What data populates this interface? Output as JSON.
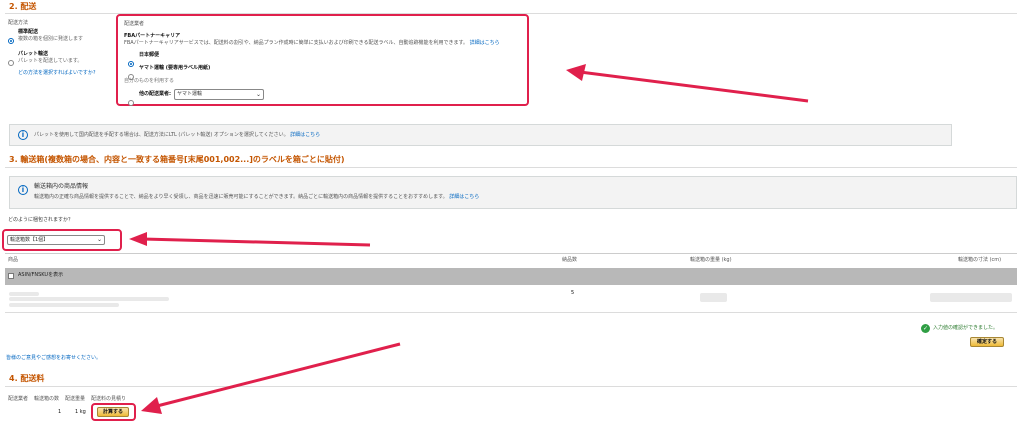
{
  "sections": {
    "s2": "2. 配送",
    "s3": "3. 輸送箱(複数箱の場合、内容と一致する箱番号[末尾001,002...]のラベルを箱ごとに貼付)",
    "s4": "4. 配送料"
  },
  "shipping_method": {
    "label": "配送方法",
    "standard": {
      "title": "標準配送",
      "desc": "複数の箱を個別に発送します",
      "selected": true
    },
    "pallet": {
      "title": "パレット輸送",
      "desc": "パレットを配送しています。",
      "selected": false
    },
    "help_link": "どの方法を選択すればよいですか?"
  },
  "carrier": {
    "label": "配送業者",
    "fba_title": "FBAパートナーキャリア",
    "fba_desc": "FBAパートナーキャリアサービスでは、配送料の割引や、納品プラン作成時に簡単に支払いおよび印刷できる配送ラベル、自動追跡機能を利用できます。",
    "fba_link": "詳細はこちら",
    "option1": "日本郵便",
    "option2": "ヤマト運輸 (要専用ラベル用紙)",
    "own_label": "自分のものを利用する",
    "other_label": "他の配送業者:",
    "other_value": "ヤマト運輸"
  },
  "pallet_notice": {
    "text": "パレットを使用して国内配送を手配する場合は、配送方法にLTL (パレット輸送) オプションを選択してください。",
    "link": "詳細はこちら"
  },
  "box_info": {
    "title": "輸送箱内の商品情報",
    "desc": "輸送箱内の正確な商品情報を提供することで、納品をより早く受領し、商品を迅速に販売可能にすることができます。納品ごとに輸送箱内の商品情報を提供することをおすすめします。",
    "link": "詳細はこちら"
  },
  "packing": {
    "question": "どのように梱包されますか？",
    "select_value": "輸送箱数【1個】"
  },
  "table": {
    "headers": [
      "商品",
      "納品数",
      "輸送箱の重量 (kg)",
      "輸送箱の寸法 (cm)"
    ],
    "toggle_label": "ASIN/FNSKUを表示",
    "row_qty": "5"
  },
  "confirm": {
    "status": "入力値の確認ができました。",
    "button": "確定する"
  },
  "feedback": "皆様のご意見やご感想をお寄せください。",
  "fee": {
    "headers": [
      "配送業者",
      "輸送箱の数",
      "配送重量",
      "配送料の見積り"
    ],
    "boxes": "1",
    "weight": "1 kg",
    "calc_button": "計算する"
  },
  "colors": {
    "section": "#c45500",
    "highlight": "#e0204c",
    "link": "#0066c0"
  }
}
